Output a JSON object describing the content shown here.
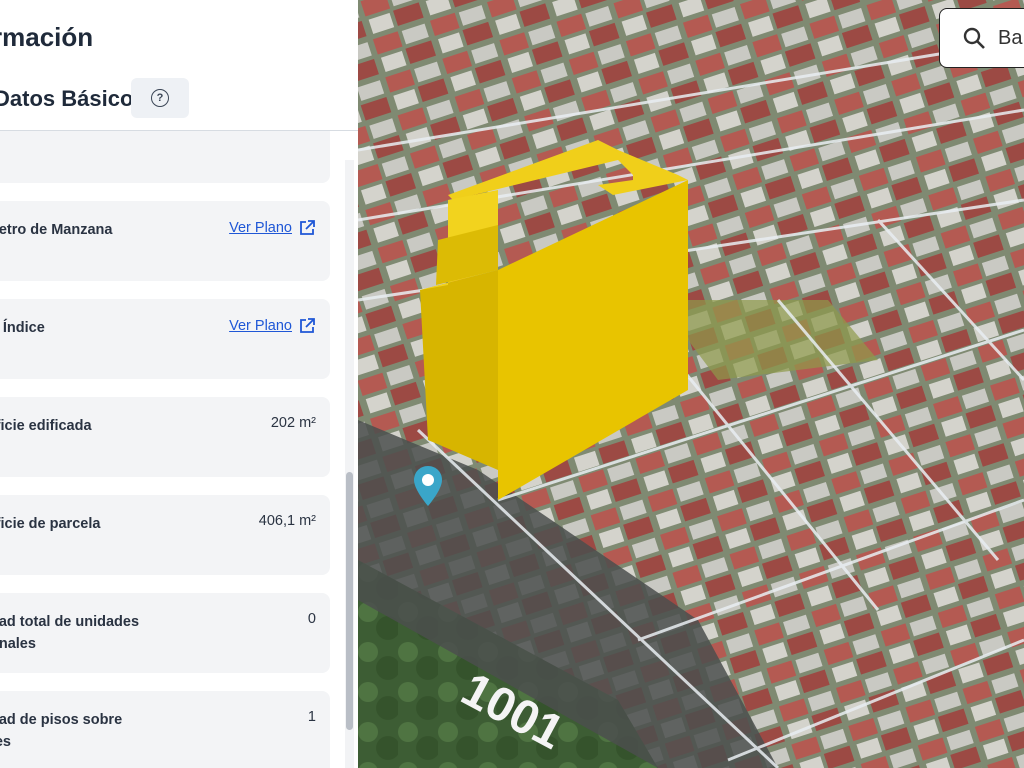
{
  "panel": {
    "title": "rmación",
    "tab_label": "Datos Básicos",
    "help_icon": "question-circle-icon"
  },
  "cards": [
    {
      "label": "",
      "value": ""
    },
    {
      "label": "netro de Manzana",
      "link": "Ver Plano",
      "icon": "external-link-icon"
    },
    {
      "label": "o Índice",
      "link": "Ver Plano",
      "icon": "external-link-icon"
    },
    {
      "label": "rficie edificada",
      "value": "202 m²"
    },
    {
      "label": "rficie de parcela",
      "value": "406,1 m²"
    },
    {
      "label": "dad total de unidades\nonales",
      "value": "0"
    },
    {
      "label": "dad de pisos sobre\ntes",
      "value": "1"
    }
  ],
  "map": {
    "search_text": "Ba",
    "search_icon": "search-icon",
    "street_number": "1001",
    "pin_icon": "map-pin-icon",
    "building_color": "#e8c400",
    "pin_color": "#3aa6c9"
  }
}
